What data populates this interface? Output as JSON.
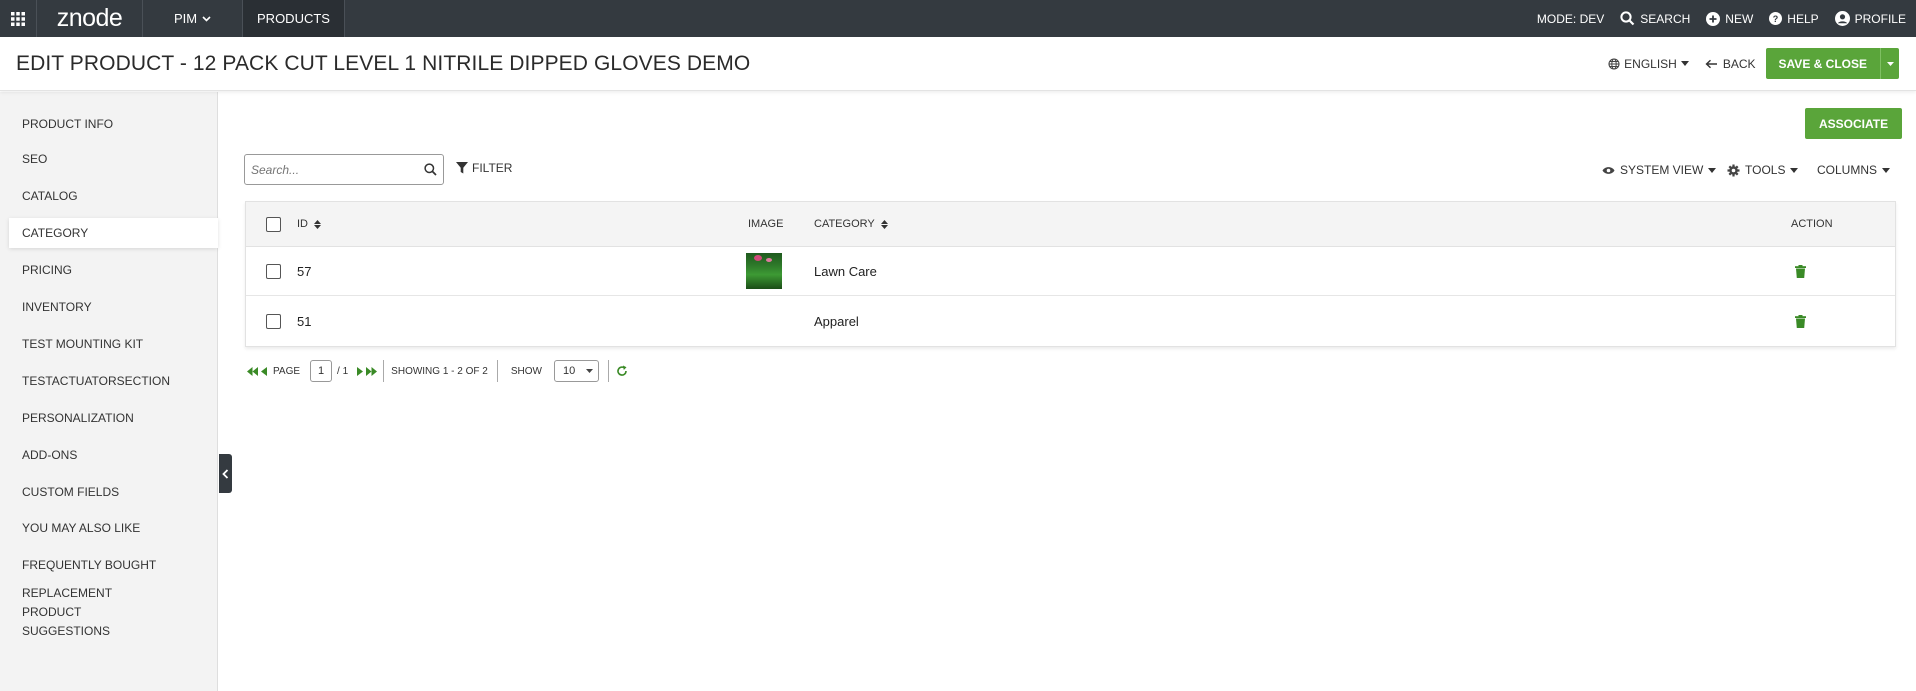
{
  "topbar": {
    "logo": "znode",
    "pim_label": "PIM",
    "products_label": "PRODUCTS",
    "mode_label": "MODE: DEV",
    "search_label": "SEARCH",
    "new_label": "NEW",
    "help_label": "HELP",
    "profile_label": "PROFILE"
  },
  "header": {
    "title": "EDIT PRODUCT  - 12 PACK CUT LEVEL 1 NITRILE DIPPED GLOVES DEMO",
    "language": "ENGLISH",
    "back_label": "BACK",
    "save_label": "SAVE & CLOSE"
  },
  "sidebar": {
    "items": [
      {
        "label": "PRODUCT INFO"
      },
      {
        "label": "SEO"
      },
      {
        "label": "CATALOG"
      },
      {
        "label": "CATEGORY",
        "active": true
      },
      {
        "label": "PRICING"
      },
      {
        "label": "INVENTORY"
      },
      {
        "label": "TEST MOUNTING KIT"
      },
      {
        "label": "TESTACTUATORSECTION"
      },
      {
        "label": "PERSONALIZATION"
      },
      {
        "label": "ADD-ONS"
      },
      {
        "label": "CUSTOM FIELDS"
      },
      {
        "label": "YOU MAY ALSO LIKE"
      },
      {
        "label": "FREQUENTLY BOUGHT"
      },
      {
        "label": "REPLACEMENT PRODUCT SUGGESTIONS"
      }
    ]
  },
  "toolbar": {
    "associate_label": "ASSOCIATE",
    "search_placeholder": "Search...",
    "filter_label": "FILTER",
    "system_view_label": "SYSTEM VIEW",
    "tools_label": "TOOLS",
    "columns_label": "COLUMNS"
  },
  "table": {
    "headers": {
      "id": "ID",
      "image": "IMAGE",
      "category": "CATEGORY",
      "action": "ACTION"
    },
    "rows": [
      {
        "id": "57",
        "has_image": true,
        "category": "Lawn Care"
      },
      {
        "id": "51",
        "has_image": false,
        "category": "Apparel"
      }
    ]
  },
  "pager": {
    "page_label": "PAGE",
    "page_value": "1",
    "page_total": "/ 1",
    "showing": "SHOWING 1 - 2 OF 2",
    "show_label": "SHOW",
    "page_size": "10"
  },
  "colors": {
    "topbar": "#343a40",
    "accent_green": "#5aa53a",
    "trash_green": "#3a8a26"
  }
}
